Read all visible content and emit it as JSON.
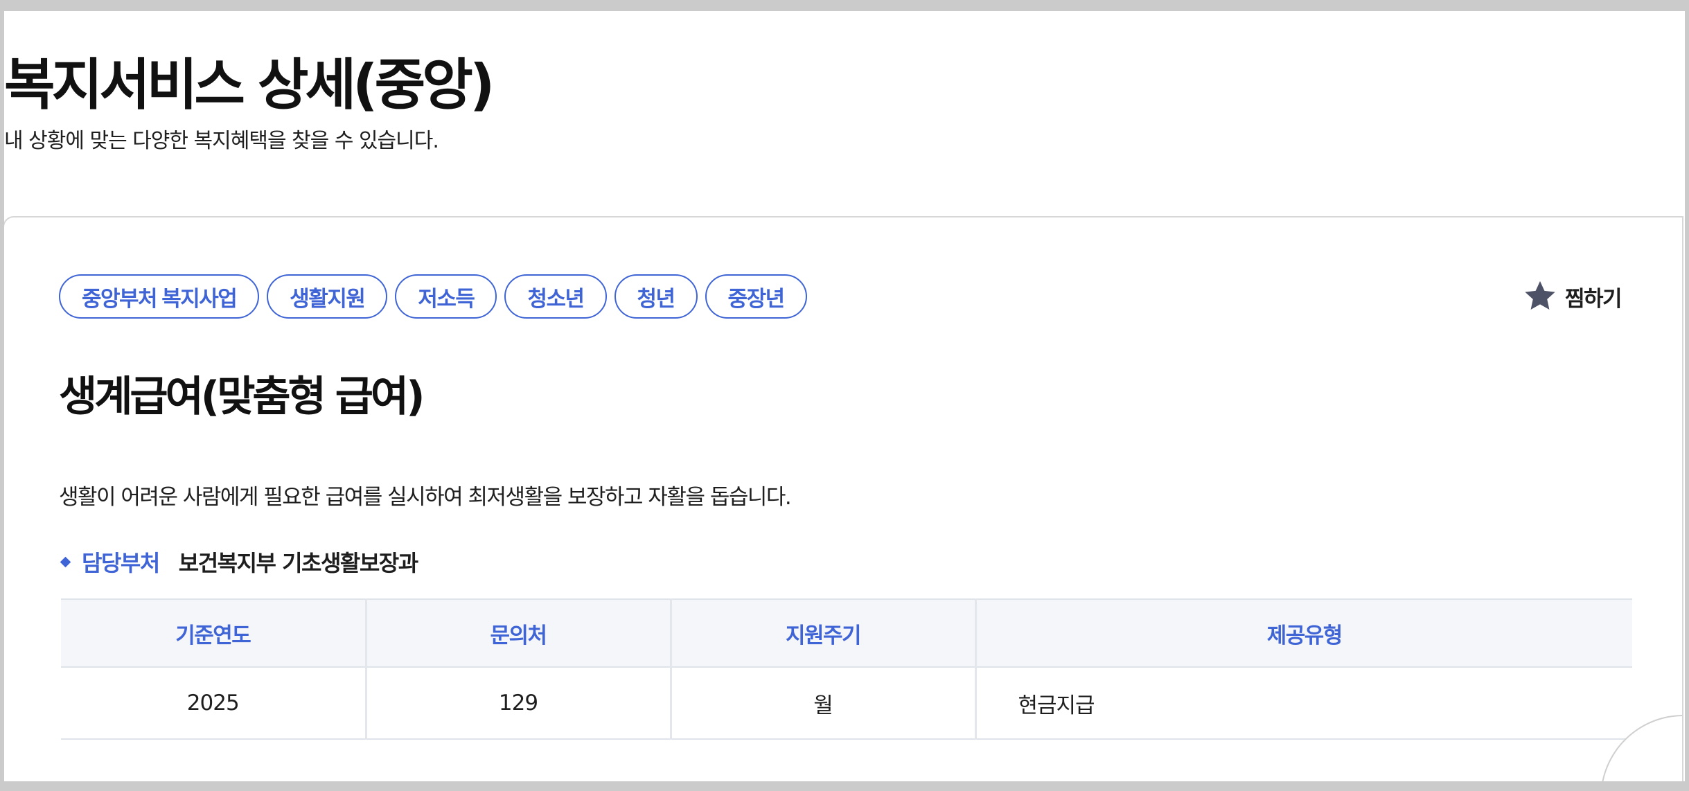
{
  "page": {
    "title": "복지서비스 상세(중앙)",
    "subtitle": "내 상황에 맞는 다양한 복지혜택을 찾을 수 있습니다."
  },
  "service": {
    "tags": [
      "중앙부처 복지사업",
      "생활지원",
      "저소득",
      "청소년",
      "청년",
      "중장년"
    ],
    "bookmark": {
      "label": "찜하기",
      "icon": "star-icon"
    },
    "title": "생계급여(맞춤형 급여)",
    "description": "생활이 어려운 사람에게 필요한 급여를 실시하여 최저생활을 보장하고 자활을 돕습니다.",
    "department": {
      "label": "담당부처",
      "value": "보건복지부 기초생활보장과"
    },
    "table": {
      "headers": [
        "기준연도",
        "문의처",
        "지원주기",
        "제공유형"
      ],
      "row": [
        "2025",
        "129",
        "월",
        "현금지급"
      ]
    }
  },
  "colors": {
    "accent": "#3f64d5",
    "star": "#4e5267",
    "table_header_bg": "#f4f6f9",
    "border": "#dfe3ea"
  }
}
